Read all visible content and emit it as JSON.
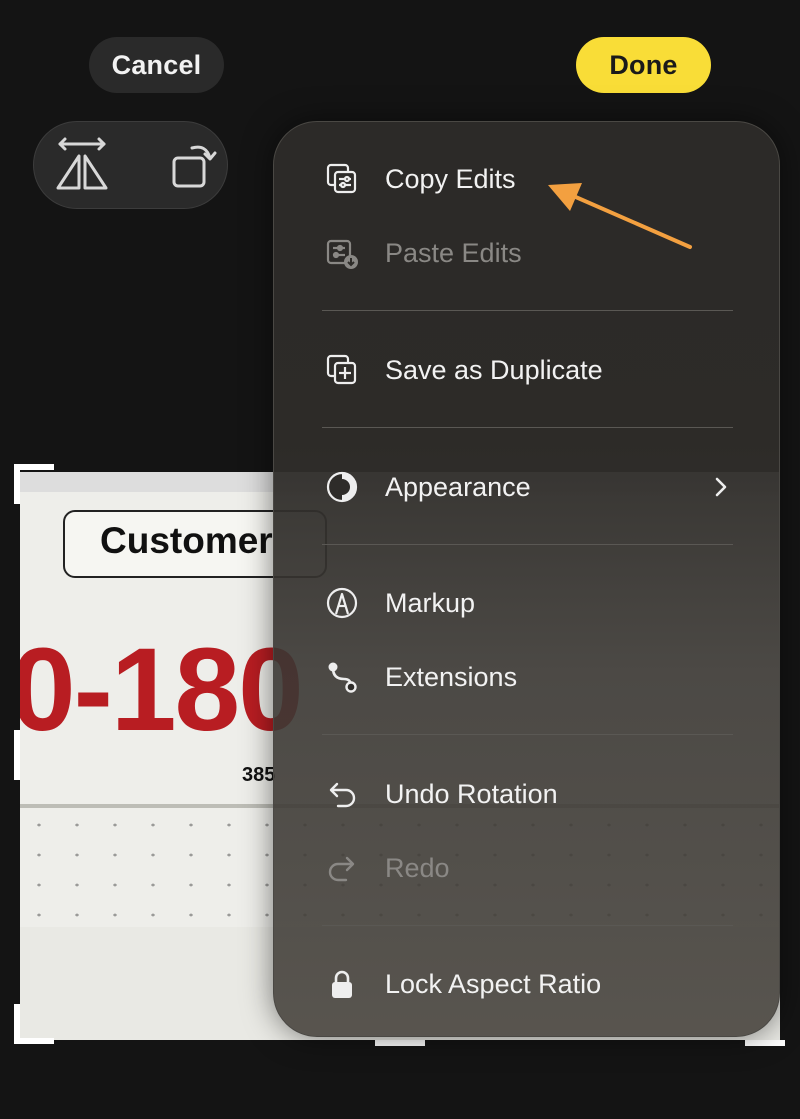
{
  "toolbar": {
    "cancel_label": "Cancel",
    "done_label": "Done"
  },
  "tools": {
    "flip_icon": "flip-horizontal-icon",
    "rotate_icon": "rotate-icon"
  },
  "photo": {
    "label_text": "Customer",
    "big_number": "0-180",
    "small_number": "385"
  },
  "menu": {
    "items": [
      {
        "label": "Copy Edits",
        "icon": "copy-edits-icon",
        "enabled": true
      },
      {
        "label": "Paste Edits",
        "icon": "paste-edits-icon",
        "enabled": false
      },
      {
        "label": "Save as Duplicate",
        "icon": "duplicate-icon",
        "enabled": true
      },
      {
        "label": "Appearance",
        "icon": "appearance-icon",
        "enabled": true,
        "submenu": true
      },
      {
        "label": "Markup",
        "icon": "markup-icon",
        "enabled": true
      },
      {
        "label": "Extensions",
        "icon": "extensions-icon",
        "enabled": true
      },
      {
        "label": "Undo Rotation",
        "icon": "undo-icon",
        "enabled": true
      },
      {
        "label": "Redo",
        "icon": "redo-icon",
        "enabled": false
      },
      {
        "label": "Lock Aspect Ratio",
        "icon": "lock-icon",
        "enabled": true
      }
    ]
  },
  "colors": {
    "accent": "#f9dd37",
    "arrow": "#f3a040",
    "background": "#141414"
  }
}
